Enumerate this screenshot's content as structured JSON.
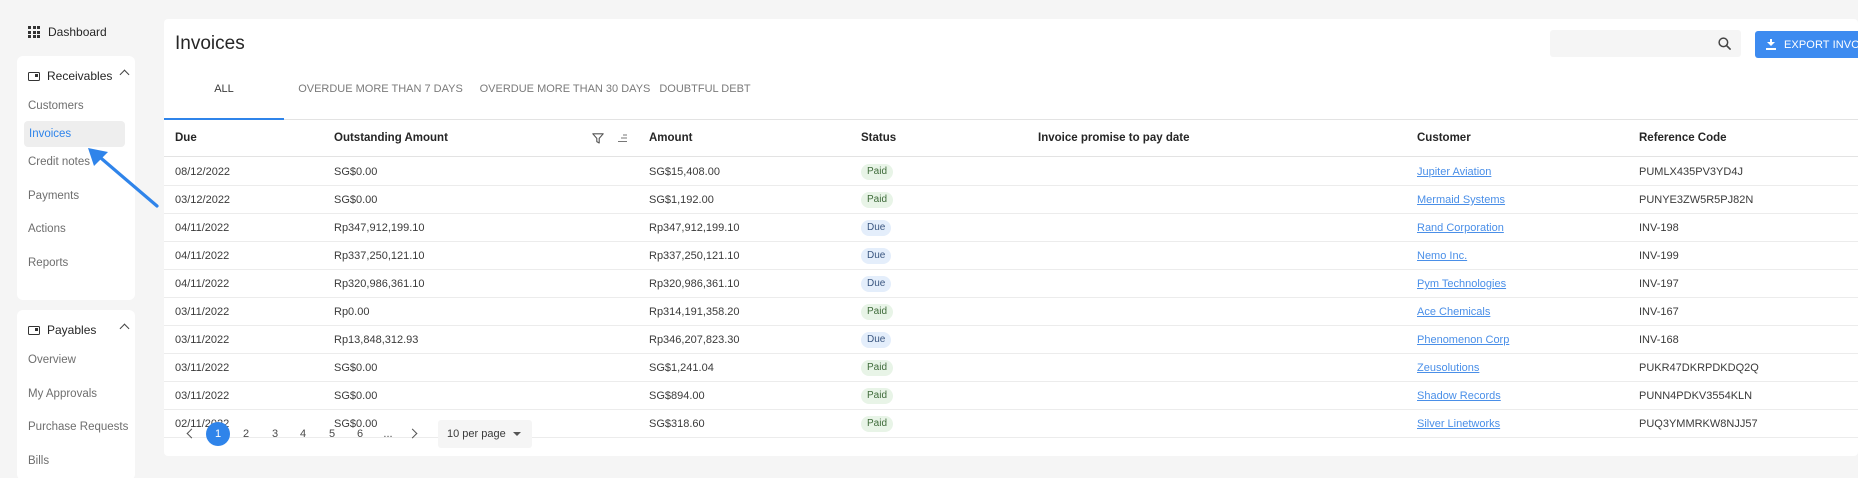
{
  "sidebar": {
    "dashboard_label": "Dashboard",
    "receivables": {
      "label": "Receivables",
      "items": [
        {
          "label": "Customers"
        },
        {
          "label": "Invoices"
        },
        {
          "label": "Credit notes"
        },
        {
          "label": "Payments"
        },
        {
          "label": "Actions"
        },
        {
          "label": "Reports"
        }
      ]
    },
    "payables": {
      "label": "Payables",
      "items": [
        {
          "label": "Overview"
        },
        {
          "label": "My Approvals"
        },
        {
          "label": "Purchase Requests"
        },
        {
          "label": "Bills"
        }
      ]
    },
    "active_item": "Invoices"
  },
  "header": {
    "title": "Invoices",
    "search_value": "",
    "export_label": "EXPORT INVOICES"
  },
  "tabs": [
    {
      "label": "ALL",
      "active": true
    },
    {
      "label": "OVERDUE MORE THAN 7 DAYS",
      "active": false
    },
    {
      "label": "OVERDUE MORE THAN 30 DAYS",
      "active": false
    },
    {
      "label": "DOUBTFUL DEBT",
      "active": false
    }
  ],
  "table": {
    "columns": [
      "Due",
      "Outstanding Amount",
      "Amount",
      "Status",
      "Invoice promise to pay date",
      "Customer",
      "Reference Code"
    ],
    "rows": [
      {
        "due": "08/12/2022",
        "outstanding": "SG$0.00",
        "amount": "SG$15,408.00",
        "status": "Paid",
        "promise": "",
        "customer": "Jupiter Aviation",
        "ref": "PUMLX435PV3YD4J"
      },
      {
        "due": "03/12/2022",
        "outstanding": "SG$0.00",
        "amount": "SG$1,192.00",
        "status": "Paid",
        "promise": "",
        "customer": "Mermaid Systems",
        "ref": "PUNYE3ZW5R5PJ82N"
      },
      {
        "due": "04/11/2022",
        "outstanding": "Rp347,912,199.10",
        "amount": "Rp347,912,199.10",
        "status": "Due",
        "promise": "",
        "customer": "Rand Corporation",
        "ref": "INV-198"
      },
      {
        "due": "04/11/2022",
        "outstanding": "Rp337,250,121.10",
        "amount": "Rp337,250,121.10",
        "status": "Due",
        "promise": "",
        "customer": "Nemo Inc.",
        "ref": "INV-199"
      },
      {
        "due": "04/11/2022",
        "outstanding": "Rp320,986,361.10",
        "amount": "Rp320,986,361.10",
        "status": "Due",
        "promise": "",
        "customer": "Pym Technologies",
        "ref": "INV-197"
      },
      {
        "due": "03/11/2022",
        "outstanding": "Rp0.00",
        "amount": "Rp314,191,358.20",
        "status": "Paid",
        "promise": "",
        "customer": "Ace Chemicals",
        "ref": "INV-167"
      },
      {
        "due": "03/11/2022",
        "outstanding": "Rp13,848,312.93",
        "amount": "Rp346,207,823.30",
        "status": "Due",
        "promise": "",
        "customer": "Phenomenon Corp",
        "ref": "INV-168"
      },
      {
        "due": "03/11/2022",
        "outstanding": "SG$0.00",
        "amount": "SG$1,241.04",
        "status": "Paid",
        "promise": "",
        "customer": "Zeusolutions",
        "ref": "PUKR47DKRPDKDQ2Q"
      },
      {
        "due": "03/11/2022",
        "outstanding": "SG$0.00",
        "amount": "SG$894.00",
        "status": "Paid",
        "promise": "",
        "customer": "Shadow Records",
        "ref": "PUNN4PDKV3554KLN"
      },
      {
        "due": "02/11/2022",
        "outstanding": "SG$0.00",
        "amount": "SG$318.60",
        "status": "Paid",
        "promise": "",
        "customer": "Silver Linetworks",
        "ref": "PUQ3YMMRKW8NJJ57"
      }
    ]
  },
  "pagination": {
    "pages": [
      "1",
      "2",
      "3",
      "4",
      "5",
      "6",
      "..."
    ],
    "current": "1",
    "per_page_label": "10 per page"
  },
  "colors": {
    "accent": "#2f84ea",
    "export_button": "#3d8bf0",
    "paid_badge_bg": "#e8f4e7",
    "due_badge_bg": "#e4eefb",
    "link": "#4a8fe8"
  }
}
